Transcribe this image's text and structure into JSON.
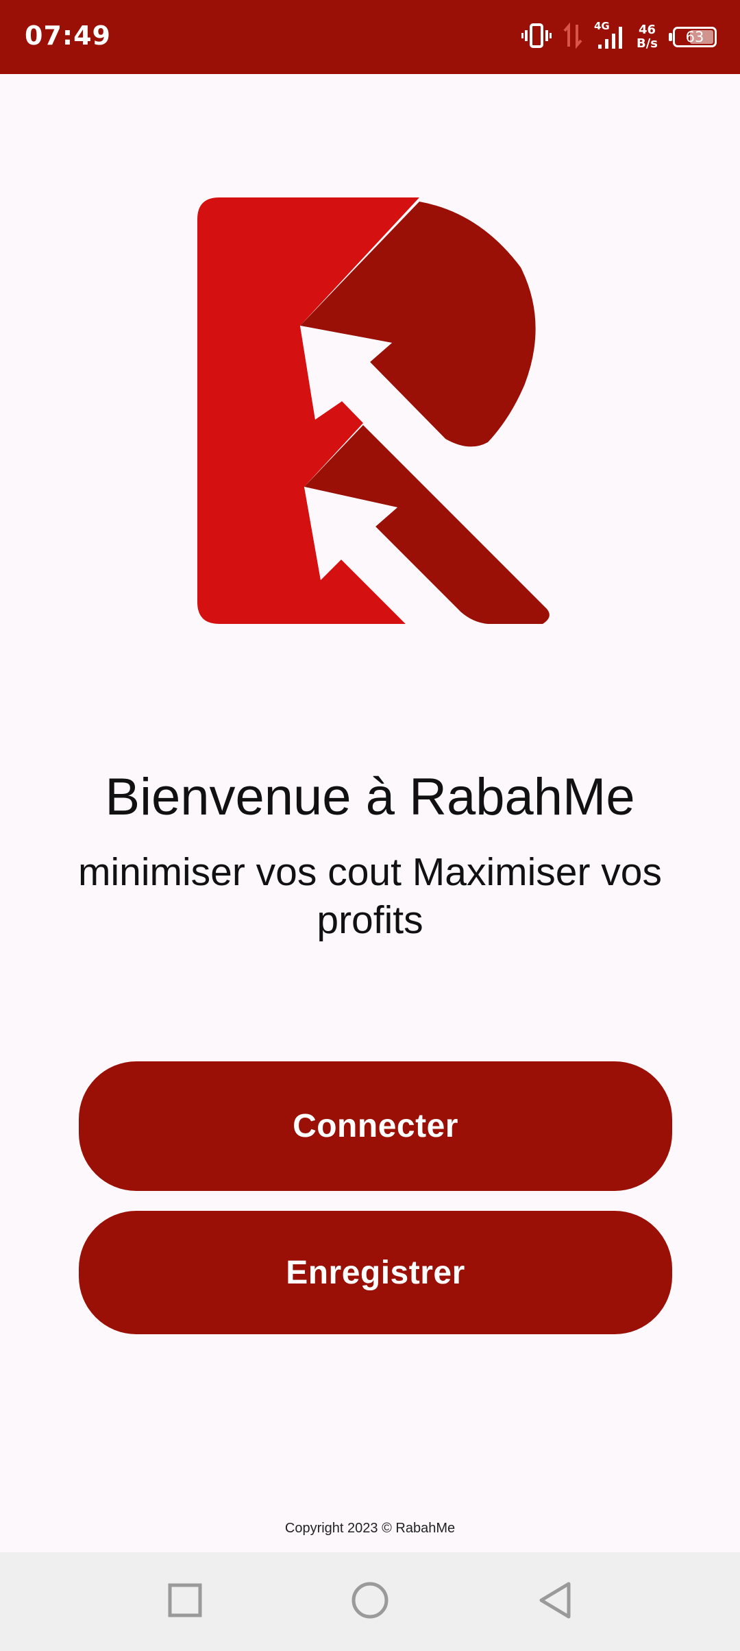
{
  "status_bar": {
    "time": "07:49",
    "network_type": "4G",
    "net_speed_value": "46",
    "net_speed_unit": "B/s",
    "battery_level": "63",
    "battery_fraction": 0.63,
    "icons": [
      "vibrate-icon",
      "data-transfer-icon",
      "signal-4g-icon",
      "battery-icon"
    ]
  },
  "logo": {
    "name": "rabahme-logo",
    "primary_color": "#d51010",
    "secondary_color": "#9a1006"
  },
  "welcome": {
    "title": "Bienvenue à RabahMe",
    "subtitle": "minimiser vos cout Maximiser vos profits"
  },
  "buttons": {
    "connect_label": "Connecter",
    "register_label": "Enregistrer"
  },
  "footer": {
    "copyright": "Copyright 2023 © RabahMe"
  },
  "nav_bar": {
    "icons": [
      "recents-square-icon",
      "home-circle-icon",
      "back-triangle-icon"
    ]
  },
  "colors": {
    "accent": "#9a1006",
    "background": "#fdf8fb",
    "nav_background": "#efefef"
  }
}
